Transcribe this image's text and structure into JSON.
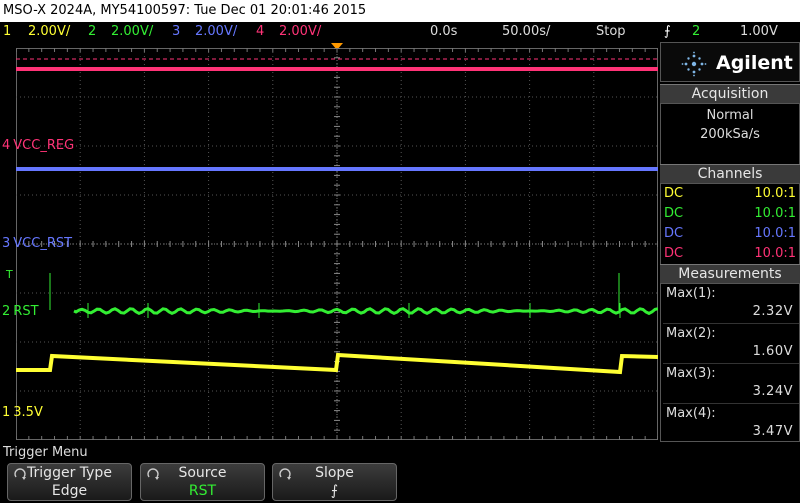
{
  "title_bar": "MSO-X 2024A, MY54100597: Tue Dec 01 20:01:46 2015",
  "scales": {
    "ch1_num": "1",
    "ch1_scale": "2.00V/",
    "ch2_num": "2",
    "ch2_scale": "2.00V/",
    "ch3_num": "3",
    "ch3_scale": "2.00V/",
    "ch4_num": "4",
    "ch4_scale": "2.00V/",
    "time_delay": "0.0s",
    "time_scale": "50.00s/",
    "run_state": "Stop",
    "trigger_symbol": "⨍",
    "trigger_source": "2",
    "trigger_level": "1.00V"
  },
  "traces": {
    "ch4_label": "VCC_REG",
    "ch4_marker": "4",
    "ch3_label": "VCC_RST",
    "ch3_marker": "3",
    "ch2_label": "RST",
    "ch2_marker": "2",
    "ch1_label": "3.5V",
    "ch1_marker": "1",
    "trigger_marker": "T"
  },
  "panel": {
    "brand": "Agilent",
    "acquisition_header": "Acquisition",
    "acq_mode": "Normal",
    "acq_rate": "200kSa/s",
    "channels_header": "Channels",
    "channels": [
      {
        "coupling": "DC",
        "probe": "10.0:1",
        "color": "#ffff33"
      },
      {
        "coupling": "DC",
        "probe": "10.0:1",
        "color": "#33ee33"
      },
      {
        "coupling": "DC",
        "probe": "10.0:1",
        "color": "#6677ff"
      },
      {
        "coupling": "DC",
        "probe": "10.0:1",
        "color": "#ff3377"
      }
    ],
    "measurements_header": "Measurements",
    "measurements": [
      {
        "name": "Max(1):",
        "value": "2.32V"
      },
      {
        "name": "Max(2):",
        "value": "1.60V"
      },
      {
        "name": "Max(3):",
        "value": "3.24V"
      },
      {
        "name": "Max(4):",
        "value": "3.47V"
      }
    ]
  },
  "menu": {
    "title": "Trigger Menu",
    "softkeys": [
      {
        "label": "Trigger Type",
        "value": "Edge"
      },
      {
        "label": "Source",
        "value": "RST"
      },
      {
        "label": "Slope",
        "value": "⨍"
      }
    ]
  },
  "colors": {
    "ch1": "#ffff33",
    "ch2": "#33ee33",
    "ch3": "#6677ff",
    "ch4": "#ff3377",
    "trigger": "#ff9900"
  }
}
